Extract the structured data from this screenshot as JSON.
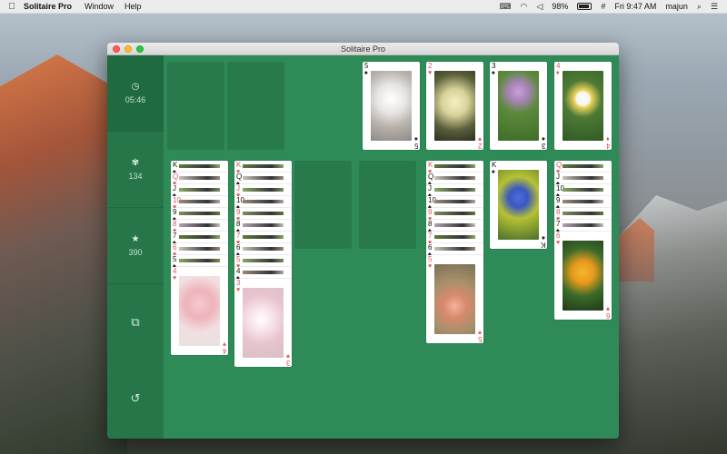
{
  "menubar": {
    "app_name": "Solitaire Pro",
    "menus": [
      "Window",
      "Help"
    ],
    "battery": "98%",
    "datetime": "Fri 9:47 AM",
    "user": "majun"
  },
  "window": {
    "title": "Solitaire Pro"
  },
  "sidebar": {
    "time": "05:46",
    "moves": "134",
    "score": "390"
  },
  "foundations": [
    {
      "rank": "5",
      "suit": "♠",
      "color": "black",
      "photo": "white-blossom"
    },
    {
      "rank": "2",
      "suit": "♥",
      "color": "red",
      "photo": "cream-flowers"
    },
    {
      "rank": "3",
      "suit": "♠",
      "color": "black",
      "photo": "purple-clover"
    },
    {
      "rank": "4",
      "suit": "♦",
      "color": "red",
      "photo": "daisy"
    }
  ],
  "tableau": [
    {
      "cards": [
        {
          "rank": "K",
          "suit": "♠",
          "color": "black"
        },
        {
          "rank": "Q",
          "suit": "♥",
          "color": "red"
        },
        {
          "rank": "J",
          "suit": "♠",
          "color": "black"
        },
        {
          "rank": "10",
          "suit": "♥",
          "color": "red"
        },
        {
          "rank": "9",
          "suit": "♠",
          "color": "black"
        },
        {
          "rank": "8",
          "suit": "♥",
          "color": "red"
        },
        {
          "rank": "7",
          "suit": "♠",
          "color": "black"
        },
        {
          "rank": "6",
          "suit": "♥",
          "color": "red"
        },
        {
          "rank": "5",
          "suit": "♠",
          "color": "black"
        },
        {
          "rank": "4",
          "suit": "♥",
          "color": "red",
          "photo": "pink-carnations"
        }
      ]
    },
    {
      "cards": [
        {
          "rank": "K",
          "suit": "♥",
          "color": "red"
        },
        {
          "rank": "Q",
          "suit": "♠",
          "color": "black"
        },
        {
          "rank": "J",
          "suit": "♥",
          "color": "red"
        },
        {
          "rank": "10",
          "suit": "♠",
          "color": "black"
        },
        {
          "rank": "9",
          "suit": "♥",
          "color": "red"
        },
        {
          "rank": "8",
          "suit": "♠",
          "color": "black"
        },
        {
          "rank": "7",
          "suit": "♥",
          "color": "red"
        },
        {
          "rank": "6",
          "suit": "♠",
          "color": "black"
        },
        {
          "rank": "5",
          "suit": "♥",
          "color": "red"
        },
        {
          "rank": "4",
          "suit": "♠",
          "color": "black"
        },
        {
          "rank": "3",
          "suit": "♥",
          "color": "red",
          "photo": "cherry-blossom"
        }
      ]
    },
    {
      "cards": []
    },
    {
      "cards": []
    },
    {
      "cards": [
        {
          "rank": "K",
          "suit": "♥",
          "color": "red"
        },
        {
          "rank": "Q",
          "suit": "♠",
          "color": "black"
        },
        {
          "rank": "J",
          "suit": "♠",
          "color": "black"
        },
        {
          "rank": "10",
          "suit": "♠",
          "color": "black"
        },
        {
          "rank": "9",
          "suit": "♥",
          "color": "red"
        },
        {
          "rank": "8",
          "suit": "♠",
          "color": "black"
        },
        {
          "rank": "7",
          "suit": "♥",
          "color": "red"
        },
        {
          "rank": "6",
          "suit": "♠",
          "color": "black"
        },
        {
          "rank": "5",
          "suit": "♥",
          "color": "red",
          "photo": "pink-hyacinth"
        }
      ]
    },
    {
      "cards": [
        {
          "rank": "K",
          "suit": "♠",
          "color": "black",
          "photo": "blue-flowers"
        }
      ]
    },
    {
      "cards": [
        {
          "rank": "Q",
          "suit": "♥",
          "color": "red"
        },
        {
          "rank": "J",
          "suit": "♠",
          "color": "black"
        },
        {
          "rank": "10",
          "suit": "♠",
          "color": "black"
        },
        {
          "rank": "9",
          "suit": "♠",
          "color": "black"
        },
        {
          "rank": "8",
          "suit": "♥",
          "color": "red"
        },
        {
          "rank": "7",
          "suit": "♠",
          "color": "black"
        },
        {
          "rank": "6",
          "suit": "♥",
          "color": "red",
          "photo": "yellow-flowers"
        }
      ]
    }
  ],
  "colors": {
    "felt": "#2e8b57",
    "sidebar": "#27764a",
    "slot": "#287a4c",
    "red_suit": "#e05656"
  }
}
